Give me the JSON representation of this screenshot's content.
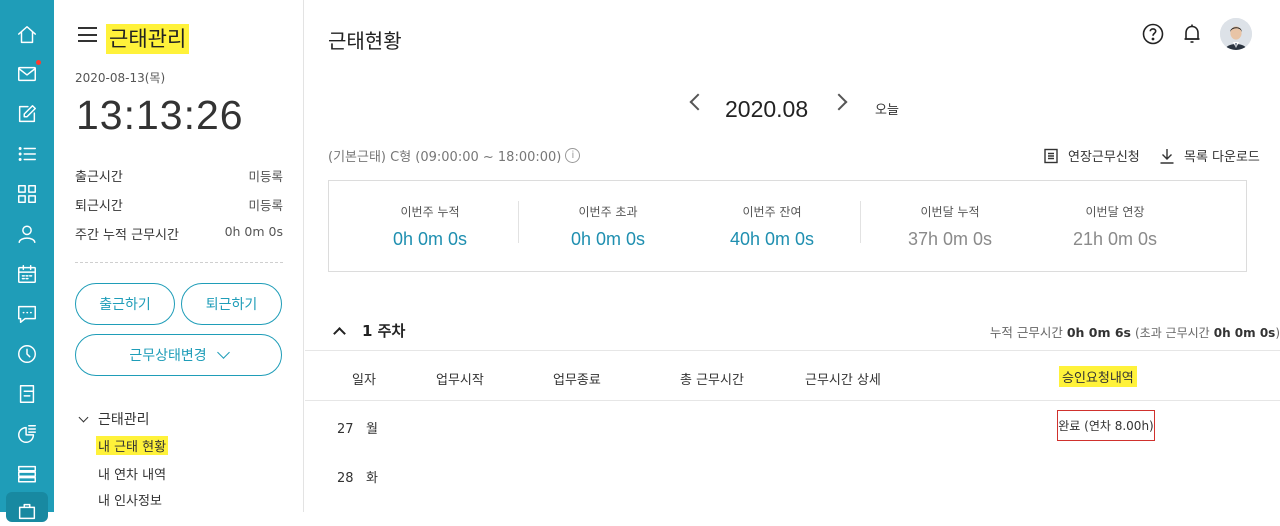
{
  "app": {
    "title": "근태관리",
    "date": "2020-08-13(목)",
    "clock": "13:13:26"
  },
  "stats": [
    {
      "label": "출근시간",
      "value": "미등록"
    },
    {
      "label": "퇴근시간",
      "value": "미등록"
    },
    {
      "label": "주간 누적 근무시간",
      "value": "0h 0m 0s"
    }
  ],
  "buttons": {
    "check_in": "출근하기",
    "check_out": "퇴근하기",
    "status_change": "근무상태변경"
  },
  "tree": {
    "header": "근태관리",
    "items": [
      "내 근태 현황",
      "내 연차 내역",
      "내 인사정보"
    ]
  },
  "main": {
    "title": "근태현황",
    "month": "2020.08",
    "today": "오늘",
    "work_type": "(기본근태) C형 (09:00:00 ~ 18:00:00)",
    "info_icon": "i",
    "overtime_request": "연장근무신청",
    "download_list": "목록 다운로드"
  },
  "summary": [
    {
      "label": "이번주 누적",
      "value": "0h 0m 0s"
    },
    {
      "label": "이번주 초과",
      "value": "0h 0m 0s"
    },
    {
      "label": "이번주 잔여",
      "value": "40h 0m 0s"
    },
    {
      "label": "이번달 누적",
      "value": "37h 0m 0s"
    },
    {
      "label": "이번달 연장",
      "value": "21h 0m 0s"
    }
  ],
  "week": {
    "label": "1 주차",
    "total_label": "누적 근무시간",
    "total_value": "0h 0m 6s",
    "over_open": "(초과 근무시간",
    "over_value": "0h 0m 0s",
    "over_close": ")"
  },
  "table": {
    "headers": [
      "일자",
      "업무시작",
      "업무종료",
      "총 근무시간",
      "근무시간 상세",
      "승인요청내역"
    ],
    "rows": [
      {
        "day": "27",
        "weekday": "월",
        "approval": "완료 (연차 8.00h)"
      },
      {
        "day": "28",
        "weekday": "화",
        "approval": ""
      }
    ]
  },
  "colors": {
    "rail": "#1f9db8",
    "accent": "#1f9db8",
    "highlight": "#fff23a",
    "alert_border": "#d0312d"
  },
  "icons": [
    "home-icon",
    "mail-icon",
    "edit-icon",
    "list-icon",
    "grid-icon",
    "user-icon",
    "calendar-icon",
    "chat-icon",
    "clock-icon",
    "report-icon",
    "chart-icon",
    "stack-icon",
    "briefcase-icon",
    "help-icon",
    "bell-icon"
  ]
}
